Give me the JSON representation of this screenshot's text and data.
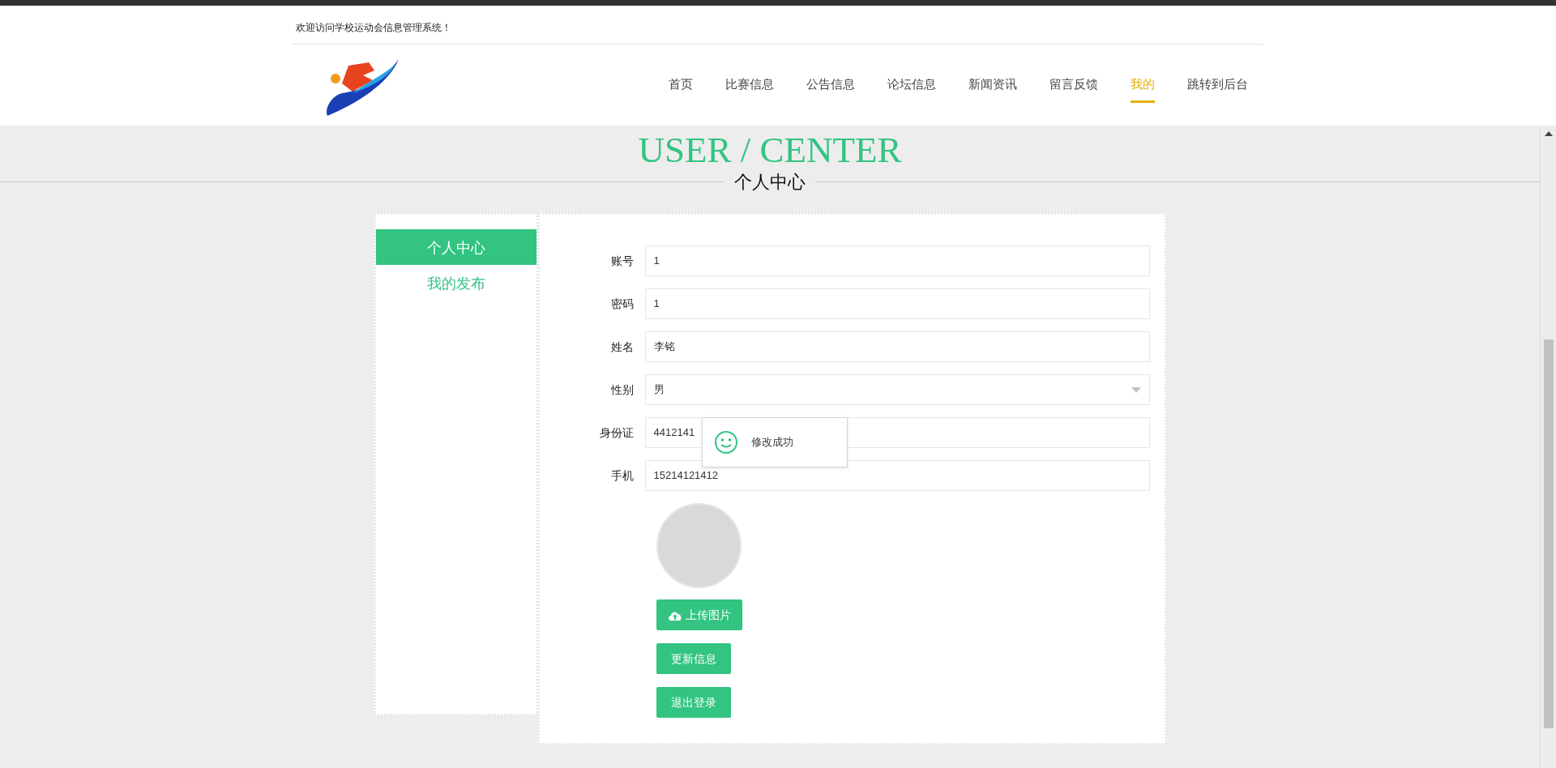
{
  "top_bar": {
    "welcome": "欢迎访问学校运动会信息管理系统！"
  },
  "nav": [
    {
      "label": "首页",
      "selected": false
    },
    {
      "label": "比赛信息",
      "selected": false
    },
    {
      "label": "公告信息",
      "selected": false
    },
    {
      "label": "论坛信息",
      "selected": false
    },
    {
      "label": "新闻资讯",
      "selected": false
    },
    {
      "label": "留言反馈",
      "selected": false
    },
    {
      "label": "我的",
      "selected": true
    },
    {
      "label": "跳转到后台",
      "selected": false
    }
  ],
  "heading": {
    "title": "USER / CENTER",
    "subtitle": "个人中心"
  },
  "sidebar": {
    "items": [
      {
        "label": "个人中心",
        "selected": true
      },
      {
        "label": "我的发布",
        "selected": false
      }
    ]
  },
  "form": {
    "fields": [
      {
        "label": "账号",
        "kind": "input",
        "value": "1"
      },
      {
        "label": "密码",
        "kind": "input",
        "value": "1"
      },
      {
        "label": "姓名",
        "kind": "input",
        "value": "李铭"
      },
      {
        "label": "性别",
        "kind": "select",
        "value": "男"
      },
      {
        "label": "身份证",
        "kind": "input",
        "value": "4412141"
      },
      {
        "label": "手机",
        "kind": "input",
        "value": "15214121412"
      }
    ],
    "buttons": [
      {
        "label": "上传图片",
        "kind": "upload"
      },
      {
        "label": "更新信息",
        "kind": "plain"
      },
      {
        "label": "退出登录",
        "kind": "plain"
      }
    ]
  },
  "toast": {
    "message": "修改成功"
  }
}
